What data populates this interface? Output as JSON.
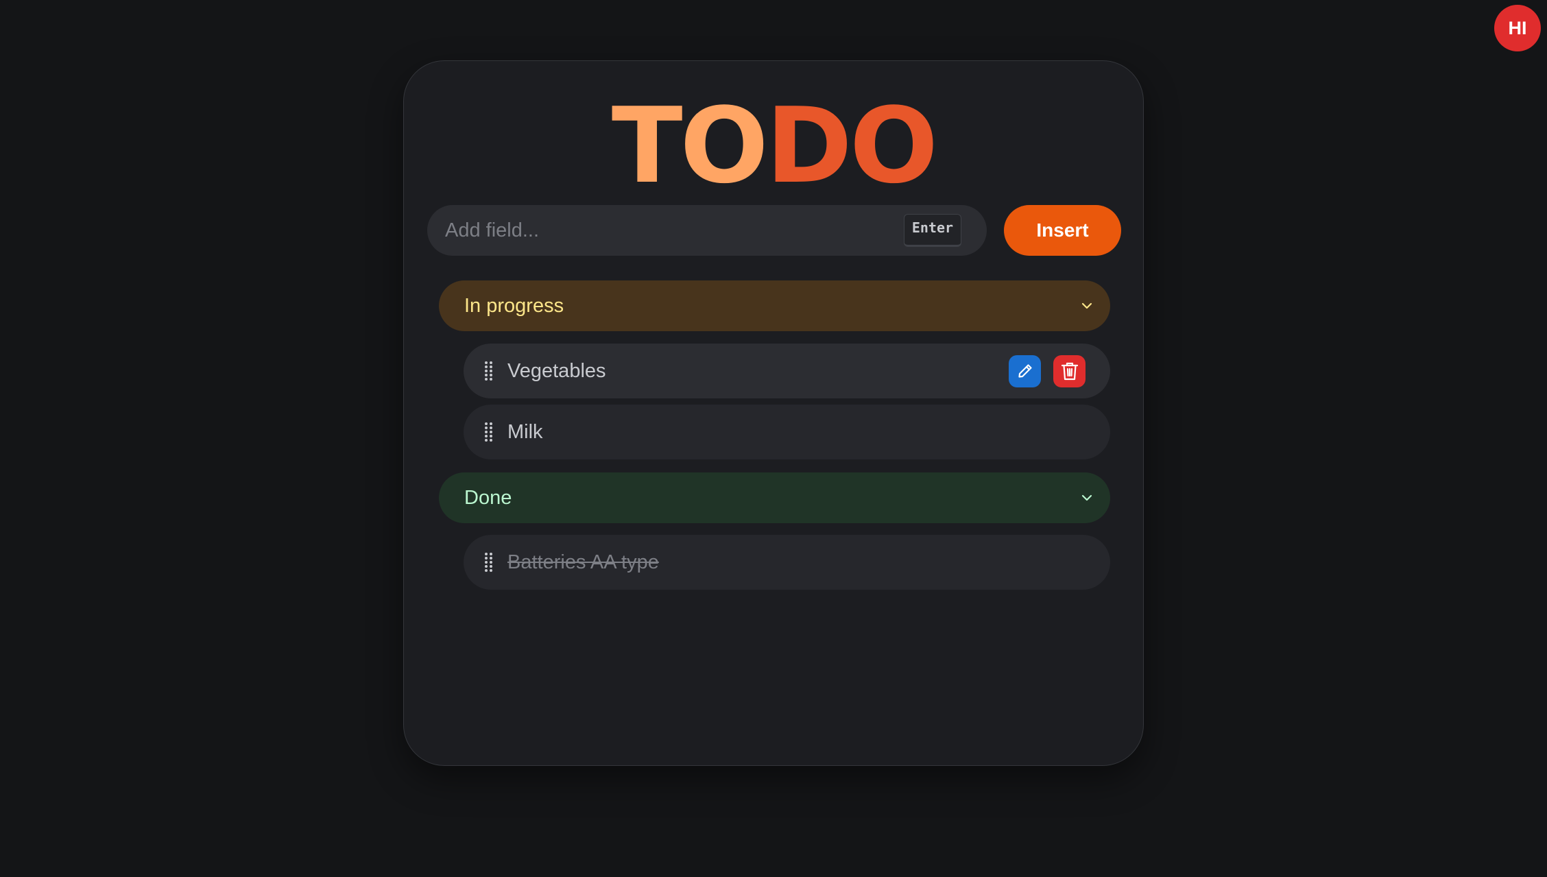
{
  "user": {
    "initials": "HI"
  },
  "app": {
    "title_part1": "TO",
    "title_part2": "DO"
  },
  "input": {
    "placeholder": "Add field...",
    "value": "",
    "shortcut_hint": "Enter"
  },
  "insert_button": {
    "label": "Insert"
  },
  "groups": [
    {
      "label": "In progress",
      "color": "#48341c",
      "text_color": "#fde68a",
      "items": [
        {
          "label": "Vegetables",
          "completed": false,
          "edit_icon": "pencil-icon",
          "delete_icon": "trash-icon"
        },
        {
          "label": "Milk",
          "completed": false
        }
      ]
    },
    {
      "label": "Done",
      "color": "#203427",
      "text_color": "#bbf7d0",
      "items": [
        {
          "label": "Batteries AA type",
          "completed": true
        }
      ]
    }
  ],
  "colors": {
    "accent": "#ea580c",
    "title_light": "#ffa564",
    "title_dark": "#e8572a",
    "edit": "#1a6fd0",
    "delete": "#e02d2d"
  }
}
